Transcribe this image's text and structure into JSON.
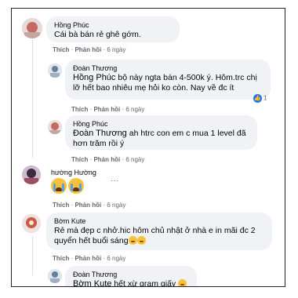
{
  "comments": [
    {
      "name": "Hồng Phúc",
      "text": "Cái bà bán rẻ ghê gớm.",
      "like": "Thích",
      "reply": "Phản hồi",
      "time": "6 ngày"
    },
    {
      "name": "Đoàn Thương",
      "mention": "Hồng Phúc",
      "text": " bộ này ngta bán 4-500k ý. Hôm.trc chị lỡ hết bao nhiêu mẹ hỏi ko còn. Nay về đc ít",
      "like": "Thích",
      "reply": "Phản hồi",
      "time": "6 ngày",
      "reaction_count": "1"
    },
    {
      "name": "Hồng Phúc",
      "mention": "Đoàn Thương",
      "text": " ah htrc con em c mua 1 level đã hơn trăm rồi ý",
      "like": "Thích",
      "reply": "Phản hồi",
      "time": "6 ngày"
    },
    {
      "name": "hường Hường",
      "like": "Thích",
      "reply": "Phản hồi",
      "time": "6 ngày",
      "more": "···"
    },
    {
      "name": "Bờm Kute",
      "text": "Rẻ mà đẹp c nhở.hic hôm chủ nhật ở nhà e in mãi đc 2 quyển hết buổi sáng",
      "like": "Thích",
      "reply": "Phản hồi",
      "time": "6 ngày"
    },
    {
      "name": "Đoàn Thương",
      "mention": "Bờm Kute",
      "text": " hết xừ gram giấy"
    }
  ],
  "colors": {
    "bubble": "#f0f2f5",
    "meta": "#65676b",
    "like": "#1877f2"
  },
  "icons": [
    "avatar",
    "crying-emoji",
    "laughing-emoji",
    "like-icon"
  ]
}
